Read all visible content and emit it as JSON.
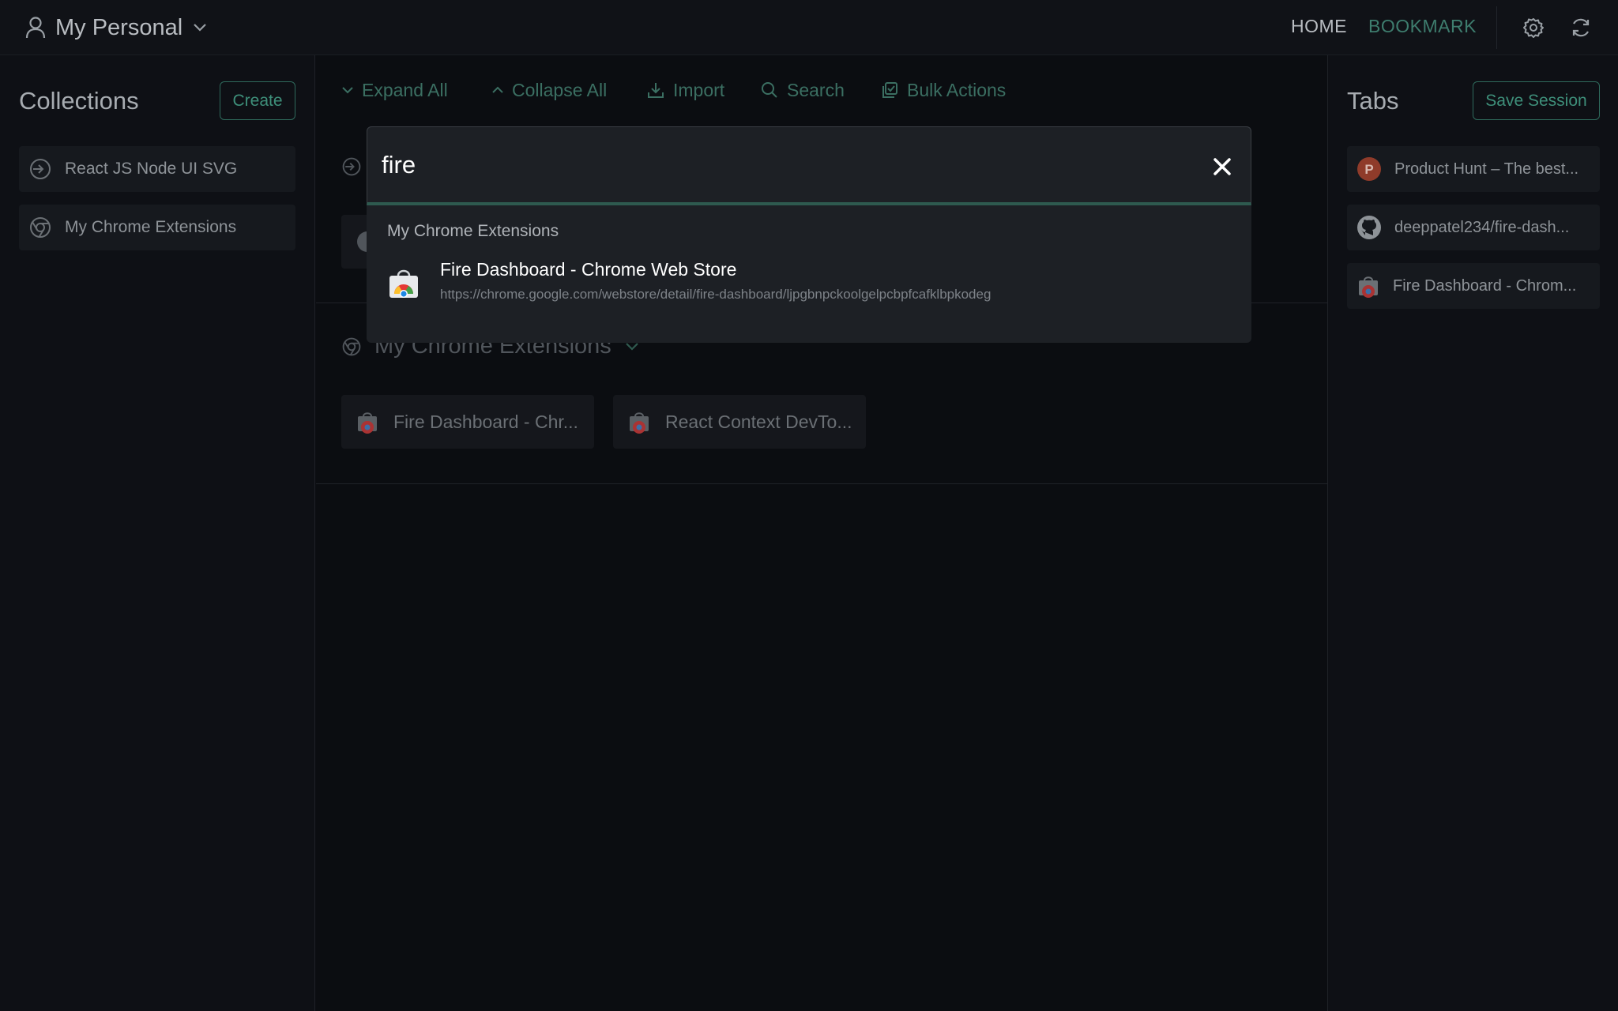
{
  "topbar": {
    "workspace_name": "My Personal",
    "nav_home": "HOME",
    "nav_bookmark": "BOOKMARK"
  },
  "left_sidebar": {
    "title": "Collections",
    "create_label": "Create",
    "items": [
      {
        "label": "React JS Node UI SVG",
        "icon": "login-arrow-icon"
      },
      {
        "label": "My Chrome Extensions",
        "icon": "chrome-icon"
      }
    ]
  },
  "toolbar": {
    "expand_all": "Expand All",
    "collapse_all": "Collapse All",
    "import": "Import",
    "search": "Search",
    "bulk_actions": "Bulk Actions"
  },
  "sections": [
    {
      "title": "My Chrome Extensions",
      "cards": [
        {
          "label": "Fire Dashboard - Chr...",
          "icon": "chrome-web-store-icon"
        },
        {
          "label": "React Context DevTo...",
          "icon": "chrome-web-store-icon"
        }
      ]
    }
  ],
  "right_sidebar": {
    "title": "Tabs",
    "save_session_label": "Save Session",
    "tabs": [
      {
        "label": "Product Hunt – The best...",
        "icon": "product-hunt-icon",
        "icon_letter": "P"
      },
      {
        "label": "deeppatel234/fire-dash...",
        "icon": "github-icon"
      },
      {
        "label": "Fire Dashboard - Chrom...",
        "icon": "chrome-web-store-icon"
      }
    ]
  },
  "search": {
    "query": "fire",
    "results": [
      {
        "group": "My Chrome Extensions",
        "title": "Fire Dashboard - Chrome Web Store",
        "url": "https://chrome.google.com/webstore/detail/fire-dashboard/ljpgbnpckoolgelpcbpfcafklbpkodeg",
        "icon": "chrome-web-store-icon"
      }
    ]
  },
  "colors": {
    "accent": "#3e8f7a",
    "background": "#0b0d11",
    "modal": "#1d2025"
  }
}
